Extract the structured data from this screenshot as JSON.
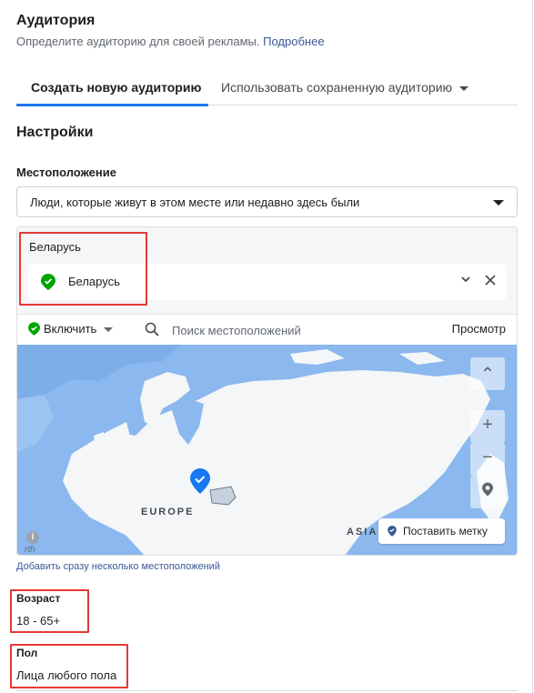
{
  "audience": {
    "title": "Аудитория",
    "subtitle": "Определите аудиторию для своей рекламы.",
    "learn_more": "Подробнее"
  },
  "tabs": [
    {
      "label": "Создать новую аудиторию",
      "active": true
    },
    {
      "label": "Использовать сохраненную аудиторию",
      "active": false
    }
  ],
  "settings": {
    "title": "Настройки",
    "location_label": "Местоположение",
    "location_type_value": "Люди, которые живут в этом месте или недавно здесь были"
  },
  "locations": {
    "country_group_label": "Беларусь",
    "selected": "Беларусь",
    "include_label": "Включить",
    "search_placeholder": "Поиск местоположений",
    "browse_label": "Просмотр"
  },
  "map": {
    "label_europe": "EUROPE",
    "label_asia": "ASIA",
    "drop_pin_label": "Поставить метку",
    "zoom_in": "+",
    "zoom_out": "−",
    "collapse": "⌃",
    "info": "i",
    "attribution": "rth"
  },
  "add_multiple_link": "Добавить сразу несколько местоположений",
  "age": {
    "label": "Возраст",
    "value": "18 - 65+"
  },
  "gender": {
    "label": "Пол",
    "value": "Лица любого пола"
  },
  "colors": {
    "accent": "#1877f2",
    "link": "#385898",
    "include_green": "#00a400",
    "highlight_red": "#e53935",
    "map_water": "#8bb8ee"
  }
}
